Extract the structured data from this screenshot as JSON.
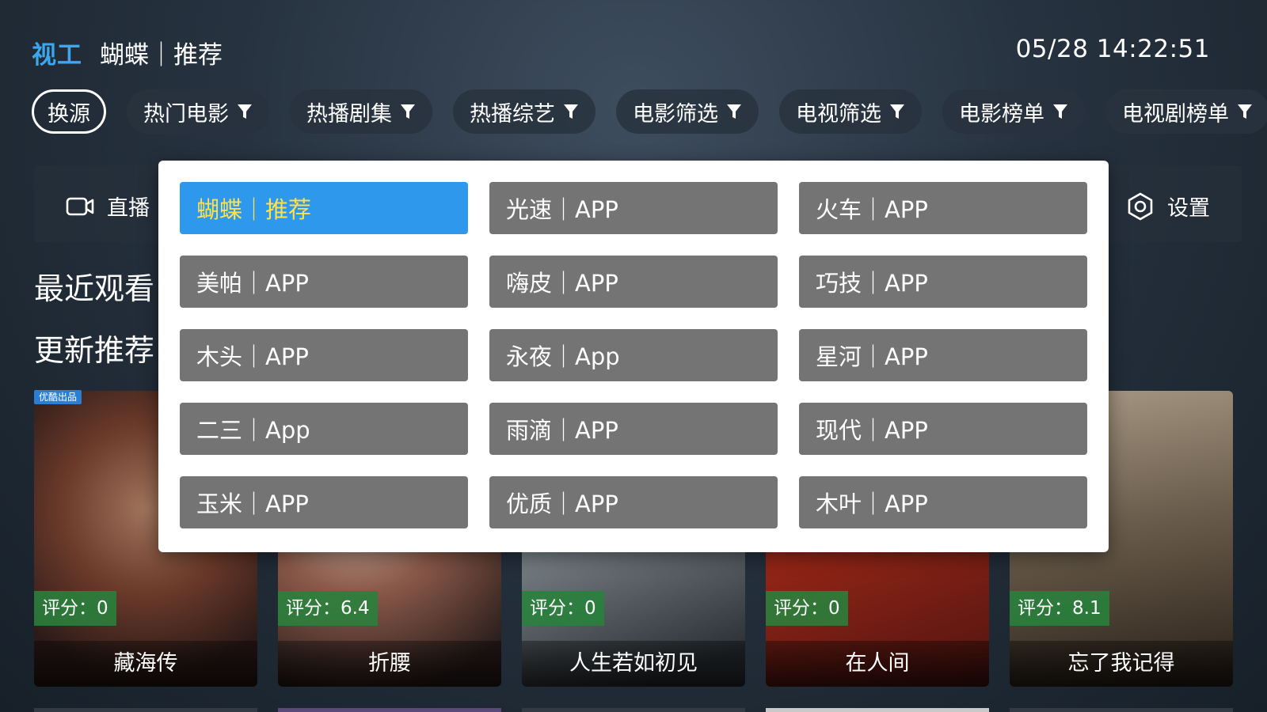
{
  "header": {
    "logo": "视工",
    "source_title": "蝴蝶｜推荐",
    "clock": "05/28 14:22:51"
  },
  "tabs": [
    {
      "label": "换源",
      "filter": false
    },
    {
      "label": "热门电影",
      "filter": true
    },
    {
      "label": "热播剧集",
      "filter": true
    },
    {
      "label": "热播综艺",
      "filter": true
    },
    {
      "label": "电影筛选",
      "filter": true
    },
    {
      "label": "电视筛选",
      "filter": true
    },
    {
      "label": "电影榜单",
      "filter": true
    },
    {
      "label": "电视剧榜单",
      "filter": true
    }
  ],
  "toolbar": {
    "live": {
      "label": "直播",
      "icon": "video-camera-icon"
    },
    "settings": {
      "label": "设置",
      "icon": "gear-icon"
    }
  },
  "sections": {
    "recent": "最近观看",
    "updates": "更新推荐"
  },
  "badge": "优酷出品",
  "cards": [
    {
      "title": "藏海传",
      "rating": "评分：0"
    },
    {
      "title": "折腰",
      "rating": "评分：6.4"
    },
    {
      "title": "人生若如初见",
      "rating": "评分：0"
    },
    {
      "title": "在人间",
      "rating": "评分：0"
    },
    {
      "title": "忘了我记得",
      "rating": "评分：8.1"
    }
  ],
  "source_menu": {
    "selected_index": 0,
    "items": [
      {
        "label": "蝴蝶｜推荐"
      },
      {
        "label": "光速｜APP"
      },
      {
        "label": "火车｜APP"
      },
      {
        "label": "美帕｜APP"
      },
      {
        "label": "嗨皮｜APP"
      },
      {
        "label": "巧技｜APP"
      },
      {
        "label": "木头｜APP"
      },
      {
        "label": "永夜｜App"
      },
      {
        "label": "星河｜APP"
      },
      {
        "label": "二三｜App"
      },
      {
        "label": "雨滴｜APP"
      },
      {
        "label": "现代｜APP"
      },
      {
        "label": "玉米｜APP"
      },
      {
        "label": "优质｜APP"
      },
      {
        "label": "木叶｜APP"
      }
    ]
  },
  "colors": {
    "accent": "#2d98ec",
    "accent_text": "#ffe14a",
    "item_bg": "#747474",
    "rating_bg": "#28823c",
    "logo": "#3aa7f0"
  }
}
